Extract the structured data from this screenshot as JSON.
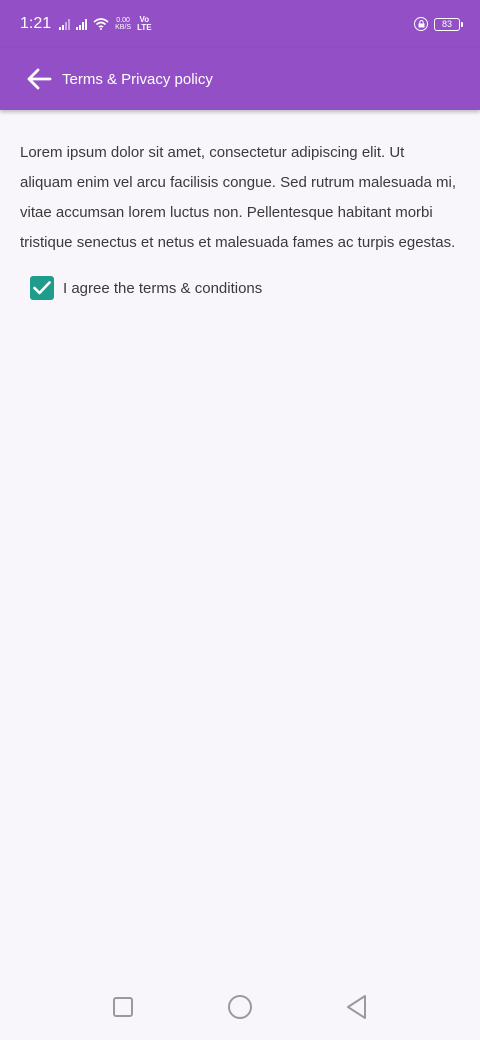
{
  "status": {
    "time": "1:21",
    "net_speed_value": "0.00",
    "net_speed_unit": "KB/S",
    "volte_top": "Vo",
    "volte_bottom": "LTE",
    "battery": "83"
  },
  "appbar": {
    "title": "Terms & Privacy policy",
    "back_icon": "arrow-left-icon"
  },
  "content": {
    "body": "Lorem ipsum dolor sit amet, consectetur adipiscing elit. Ut aliquam enim vel arcu facilisis congue. Sed rutrum malesuada mi, vitae accumsan lorem luctus non. Pellentesque habitant morbi tristique senectus et netus et malesuada fames ac turpis egestas.",
    "agree_label": "I agree the terms & conditions",
    "agree_checked": true
  },
  "navbar": {
    "items": [
      "square-icon",
      "circle-icon",
      "triangle-back-icon"
    ]
  },
  "colors": {
    "primary": "#924fc6",
    "checkbox": "#1f9c8c",
    "background": "#f8f6fb",
    "text": "#3a3a3a"
  }
}
